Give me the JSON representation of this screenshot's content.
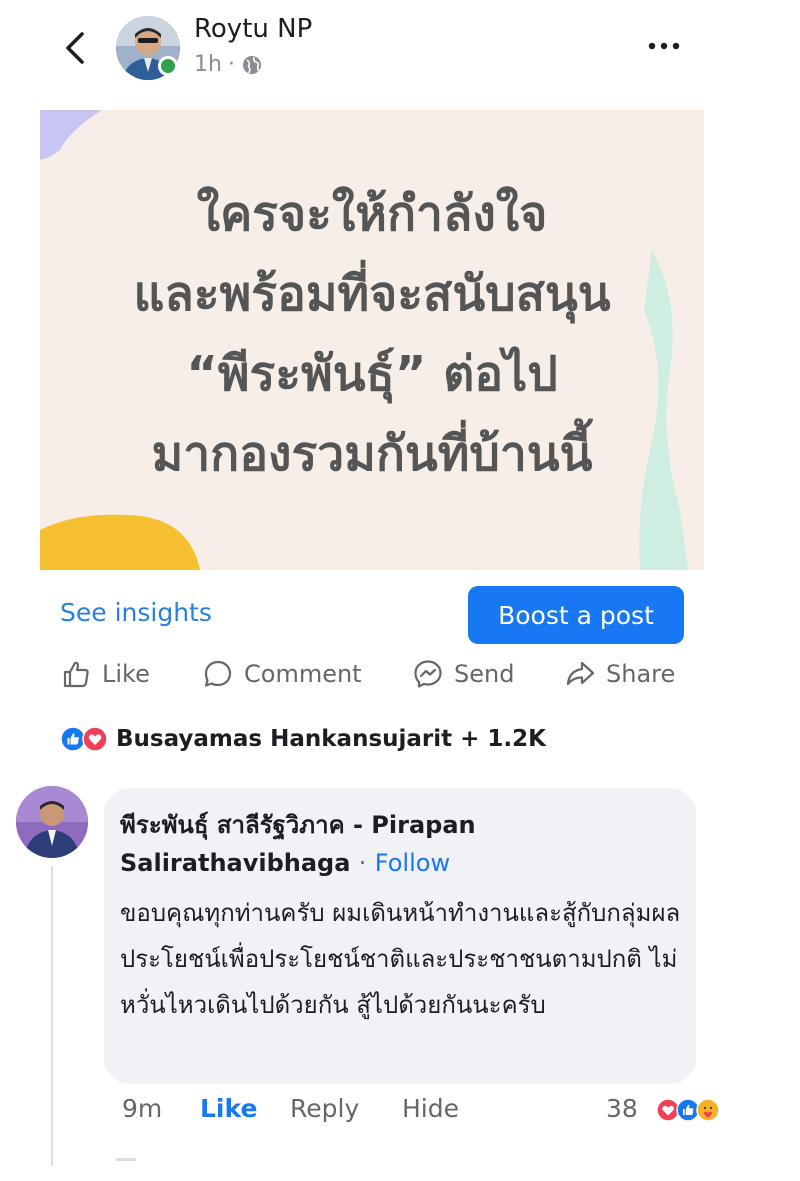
{
  "header": {
    "author_name": "Roytu NP",
    "time": "1h",
    "separator": "·",
    "icons": {
      "back": "chevron-left-icon",
      "more": "more-dots-icon",
      "privacy": "globe-icon"
    }
  },
  "post": {
    "image_text": [
      "ใครจะให้กำลังใจ",
      "และพร้อมที่จะสนับสนุน",
      "“พีระพันธุ์” ต่อไป",
      "มากองรวมกันที่บ้านนี้"
    ],
    "colors": {
      "background": "#f7efe7",
      "text": "#555555",
      "accent_yellow": "#f7c031",
      "accent_lavender": "#c7c6f2",
      "accent_mint": "#cdeee0"
    }
  },
  "insights": {
    "see_insights_label": "See insights",
    "boost_label": "Boost a post"
  },
  "actions": {
    "like_label": "Like",
    "comment_label": "Comment",
    "send_label": "Send",
    "share_label": "Share"
  },
  "reactions": {
    "summary": "Busayamas Hankansujarit + 1.2K",
    "types": [
      "like",
      "love"
    ]
  },
  "comment": {
    "author": "พีระพันธุ์ สาลีรัฐวิภาค - Pirapan Salirathavibhaga",
    "separator": "·",
    "follow_label": "Follow",
    "body": "ขอบคุณทุกท่านครับ ผมเดินหน้าทำงานและสู้กับกลุ่มผลประโยชน์เพื่อประโยชน์ชาติและประชาชนตามปกติ ไม่หวั่นไหวเดินไปด้วยกัน สู้ไปด้วยกันนะครับ",
    "time": "9m",
    "like_label": "Like",
    "reply_label": "Reply",
    "hide_label": "Hide",
    "reaction_count": "38",
    "reaction_types": [
      "love",
      "like",
      "care"
    ]
  },
  "colors": {
    "brand_blue": "#1877f2",
    "link_blue": "#2a7fdc",
    "muted": "#65676b",
    "online_green": "#31a24c",
    "love_red": "#f33e58"
  }
}
